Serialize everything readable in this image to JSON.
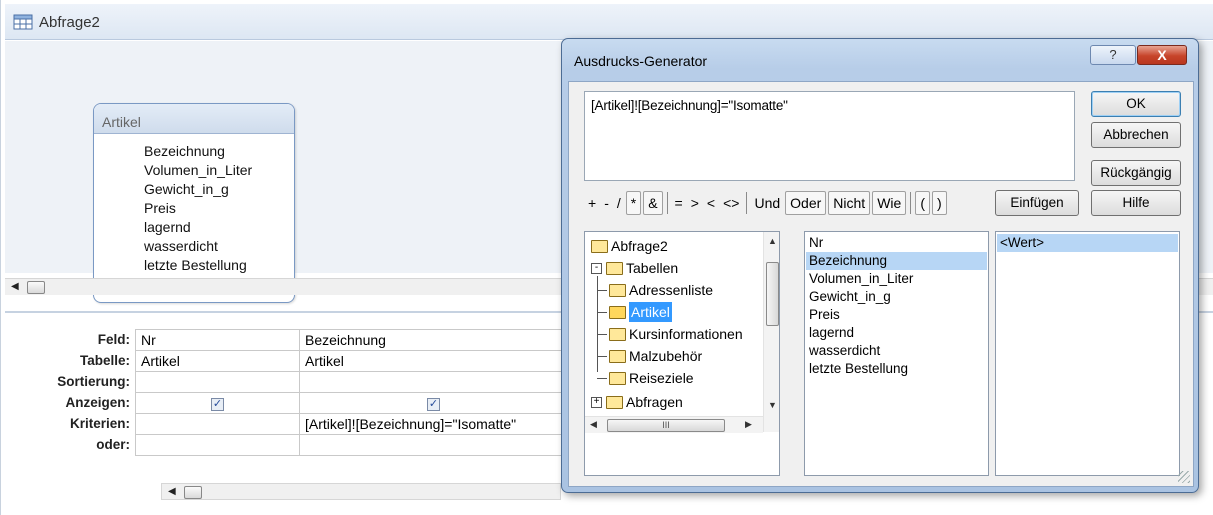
{
  "window": {
    "title": "Abfrage2"
  },
  "table": {
    "title": "Artikel",
    "fields": [
      "Bezeichnung",
      "Volumen_in_Liter",
      "Gewicht_in_g",
      "Preis",
      "lagernd",
      "wasserdicht",
      "letzte Bestellung"
    ]
  },
  "grid": {
    "row_labels": [
      "Feld:",
      "Tabelle:",
      "Sortierung:",
      "Anzeigen:",
      "Kriterien:",
      "oder:"
    ],
    "columns": [
      {
        "feld": "Nr",
        "tabelle": "Artikel",
        "sortierung": "",
        "anzeigen": true,
        "kriterien": "",
        "oder": ""
      },
      {
        "feld": "Bezeichnung",
        "tabelle": "Artikel",
        "sortierung": "",
        "anzeigen": true,
        "kriterien": "[Artikel]![Bezeichnung]=\"Isomatte\"",
        "oder": ""
      }
    ]
  },
  "dialog": {
    "title": "Ausdrucks-Generator",
    "help_glyph": "?",
    "close_glyph": "X",
    "expression": "[Artikel]![Bezeichnung]=\"Isomatte\"",
    "buttons": {
      "ok": "OK",
      "cancel": "Abbrechen",
      "undo": "Rückgängig",
      "help": "Hilfe",
      "paste": "Einfügen"
    },
    "operators": [
      "+",
      "-",
      "/",
      "*",
      "&",
      "=",
      ">",
      "<",
      "<>",
      "Und",
      "Oder",
      "Nicht",
      "Wie",
      "(",
      ")"
    ],
    "tree": {
      "root": "Abfrage2",
      "tables_node": "Tabellen",
      "tables": [
        "Adressenliste",
        "Artikel",
        "Kursinformationen",
        "Malzubehör",
        "Reiseziele"
      ],
      "selected_table": "Artikel",
      "queries_node": "Abfragen"
    },
    "fields": [
      "Nr",
      "Bezeichnung",
      "Volumen_in_Liter",
      "Gewicht_in_g",
      "Preis",
      "lagernd",
      "wasserdicht",
      "letzte Bestellung"
    ],
    "selected_field": "Bezeichnung",
    "values": [
      "<Wert>"
    ]
  }
}
